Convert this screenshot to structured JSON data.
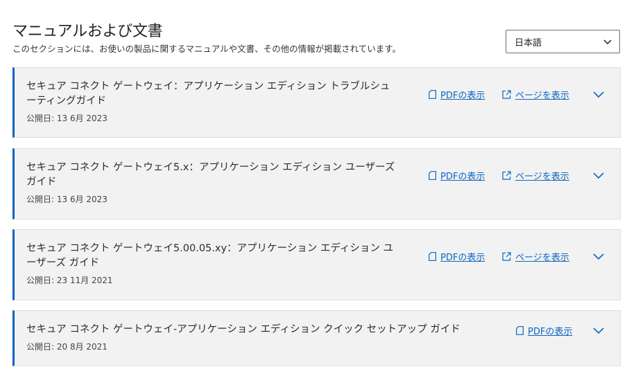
{
  "header": {
    "title": "マニュアルおよび文書",
    "description": "このセクションには、お使いの製品に関するマニュアルや文書、その他の情報が掲載されています。"
  },
  "language_select": {
    "value": "日本語"
  },
  "actions": {
    "pdf_label": "PDFの表示",
    "page_label": "ページを表示"
  },
  "documents": [
    {
      "title": "セキュア コネクト ゲートウェイ：アプリケーション エディション トラブルシューティングガイド",
      "date": "公開日: 13 6月 2023"
    },
    {
      "title": "セキュア コネクト ゲートウェイ5.x：アプリケーション エディション ユーザーズガイド",
      "date": "公開日: 13 6月 2023"
    },
    {
      "title": "セキュア コネクト ゲートウェイ5.00.05.xy：アプリケーション エディション ユーザーズ ガイド",
      "date": "公開日: 23 11月 2021"
    },
    {
      "title": "セキュア コネクト ゲートウェイ-アプリケーション エディション クイック セットアップ ガイド",
      "date": "公開日: 20 8月 2021"
    }
  ],
  "colors": {
    "accent": "#0b65c2",
    "card_bg": "#f2f2f2"
  },
  "icons": {
    "pdf": "document-icon",
    "page": "external-link-icon",
    "expand": "chevron-down-icon",
    "select": "chevron-down-icon"
  }
}
